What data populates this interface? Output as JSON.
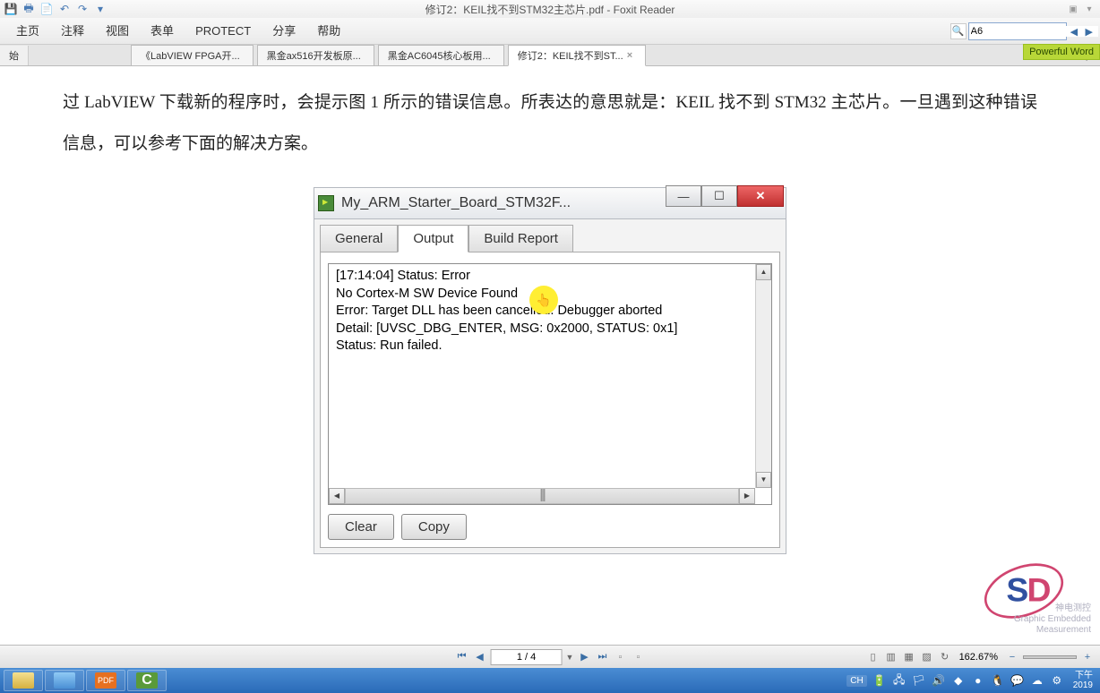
{
  "window": {
    "title": "修订2：KEIL找不到STM32主芯片.pdf - Foxit Reader"
  },
  "menu": {
    "items": [
      "主页",
      "注释",
      "视图",
      "表单",
      "PROTECT",
      "分享",
      "帮助"
    ]
  },
  "search": {
    "value": "A6"
  },
  "corner_tab": {
    "label": "始"
  },
  "doc_tabs": [
    {
      "label": "《LabVIEW FPGA开...",
      "active": false
    },
    {
      "label": "黑金ax516开发板原...",
      "active": false
    },
    {
      "label": "黑金AC6045核心板用...",
      "active": false
    },
    {
      "label": "修订2：KEIL找不到ST...",
      "active": true
    }
  ],
  "right_badge": "Powerful Word",
  "document": {
    "para1": "过 LabVIEW 下载新的程序时，会提示图 1 所示的错误信息。所表达的意思就是：KEIL 找不到 STM32 主芯片。一旦遇到这种错误信息，可以参考下面的解决方案。"
  },
  "dialog": {
    "title": "My_ARM_Starter_Board_STM32F...",
    "tabs": {
      "general": "General",
      "output": "Output",
      "build": "Build Report"
    },
    "output_lines": [
      "[17:14:04] Status: Error",
      "No Cortex-M SW Device Found",
      "Error: Target DLL has been cancelled. Debugger aborted",
      "",
      "Detail: [UVSC_DBG_ENTER, MSG: 0x2000, STATUS: 0x1]",
      "Status: Run failed."
    ],
    "clear_btn": "Clear",
    "copy_btn": "Copy"
  },
  "pager": {
    "page": "1 / 4",
    "zoom": "162.67%"
  },
  "tray": {
    "ime": "CH",
    "time_line1": "下午",
    "time_line2": "2019"
  },
  "watermark": {
    "line1": "神电测控",
    "line2": "Graphic Embedded",
    "line3": "Measurement"
  }
}
